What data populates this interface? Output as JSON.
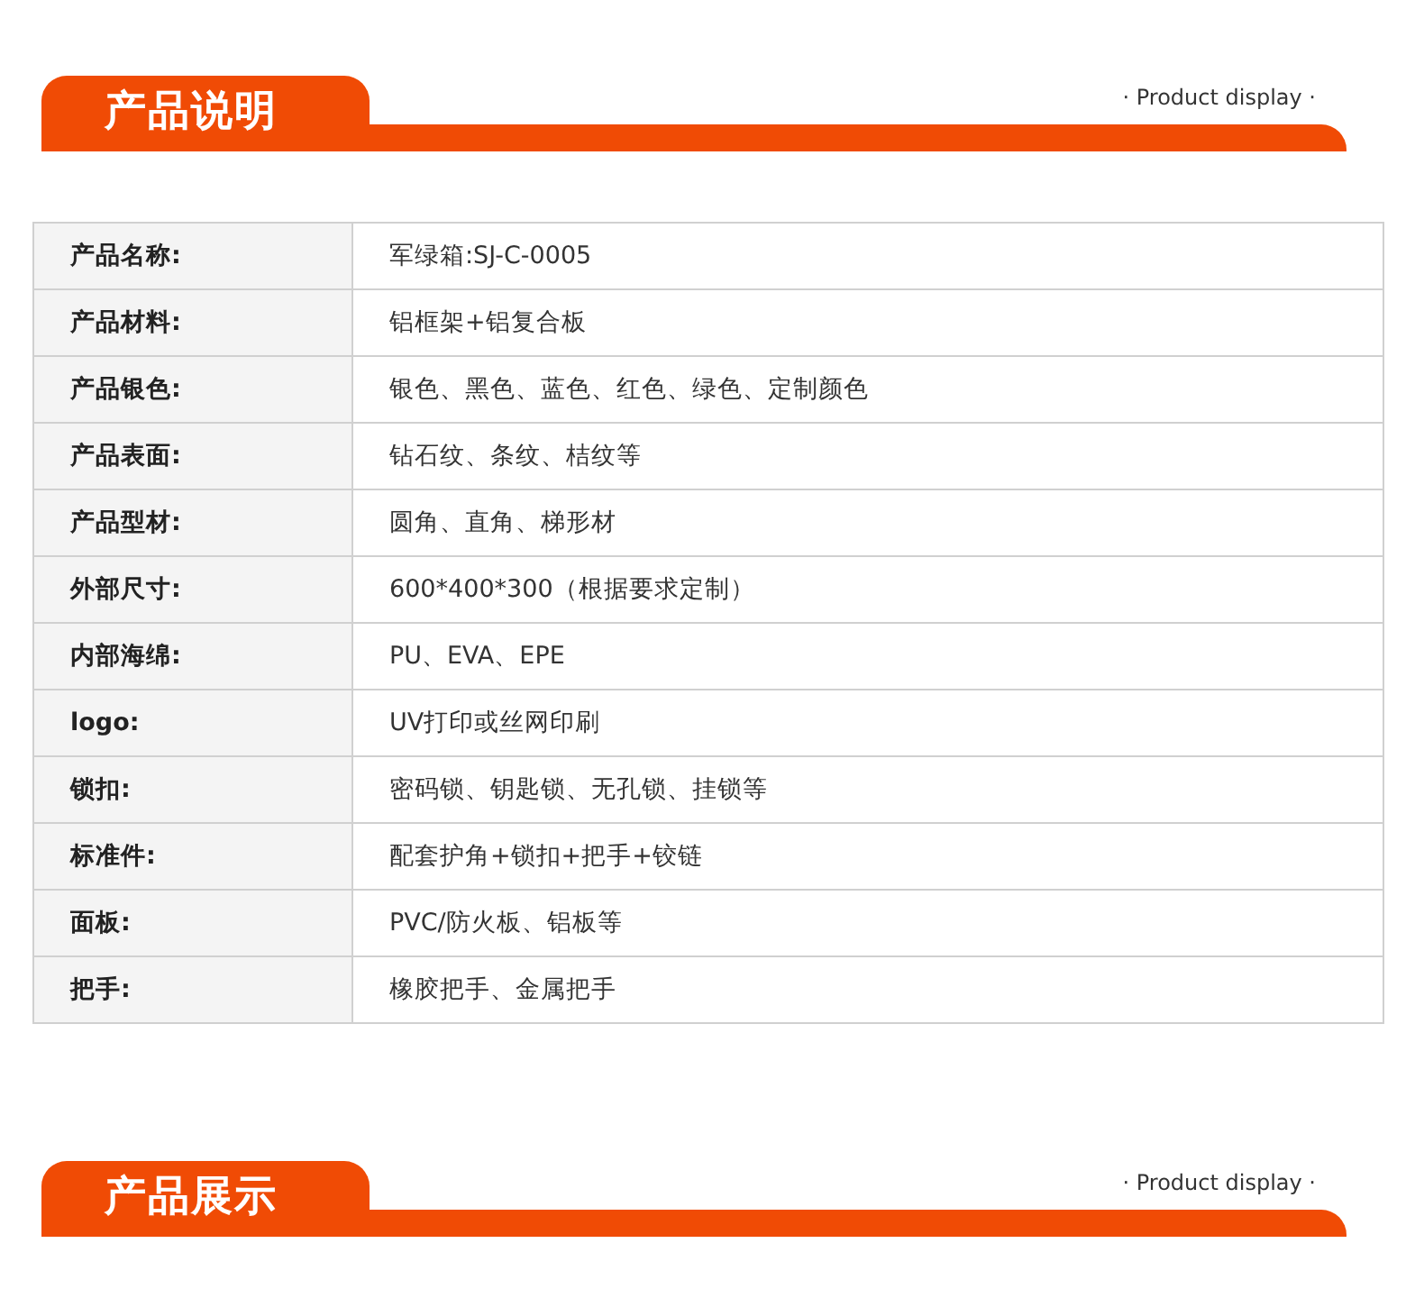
{
  "sections": [
    {
      "title": "产品说明",
      "subtitle": "· Product display ·",
      "specs": [
        {
          "label": "产品名称:",
          "value": "军绿箱:SJ-C-0005"
        },
        {
          "label": "产品材料:",
          "value": "铝框架+铝复合板"
        },
        {
          "label": "产品银色:",
          "value": "银色、黑色、蓝色、红色、绿色、定制颜色"
        },
        {
          "label": "产品表面:",
          "value": "钻石纹、条纹、桔纹等"
        },
        {
          "label": "产品型材:",
          "value": "圆角、直角、梯形材"
        },
        {
          "label": "外部尺寸:",
          "value": "600*400*300（根据要求定制）"
        },
        {
          "label": "内部海绵:",
          "value": "PU、EVA、EPE"
        },
        {
          "label": "logo:",
          "value": "UV打印或丝网印刷"
        },
        {
          "label": "锁扣:",
          "value": "密码锁、钥匙锁、无孔锁、挂锁等"
        },
        {
          "label": "标准件:",
          "value": "配套护角+锁扣+把手+铰链"
        },
        {
          "label": "面板:",
          "value": "PVC/防火板、铝板等"
        },
        {
          "label": "把手:",
          "value": "橡胶把手、金属把手"
        }
      ]
    },
    {
      "title": "产品展示",
      "subtitle": "· Product display ·"
    }
  ]
}
